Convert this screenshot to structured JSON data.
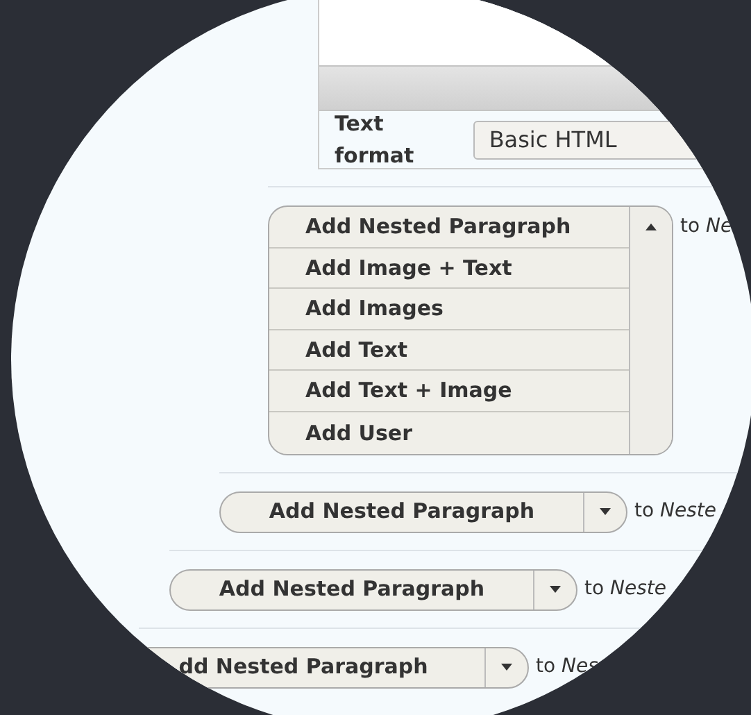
{
  "editor": {
    "format_label": "Text format",
    "format_value": "Basic HTML"
  },
  "open_dropdown": {
    "expanded": true,
    "items": [
      "Add Nested Paragraph",
      "Add Image + Text",
      "Add Images",
      "Add Text",
      "Add Text + Image",
      "Add User"
    ],
    "suffix": "to *Ne*"
  },
  "rows": [
    {
      "button": "Add Nested Paragraph",
      "suffix": "to *Neste*"
    },
    {
      "button": "Add Nested Paragraph",
      "suffix": "to *Neste*"
    },
    {
      "button": "dd Nested Paragraph",
      "suffix": "to *Nes*"
    }
  ]
}
